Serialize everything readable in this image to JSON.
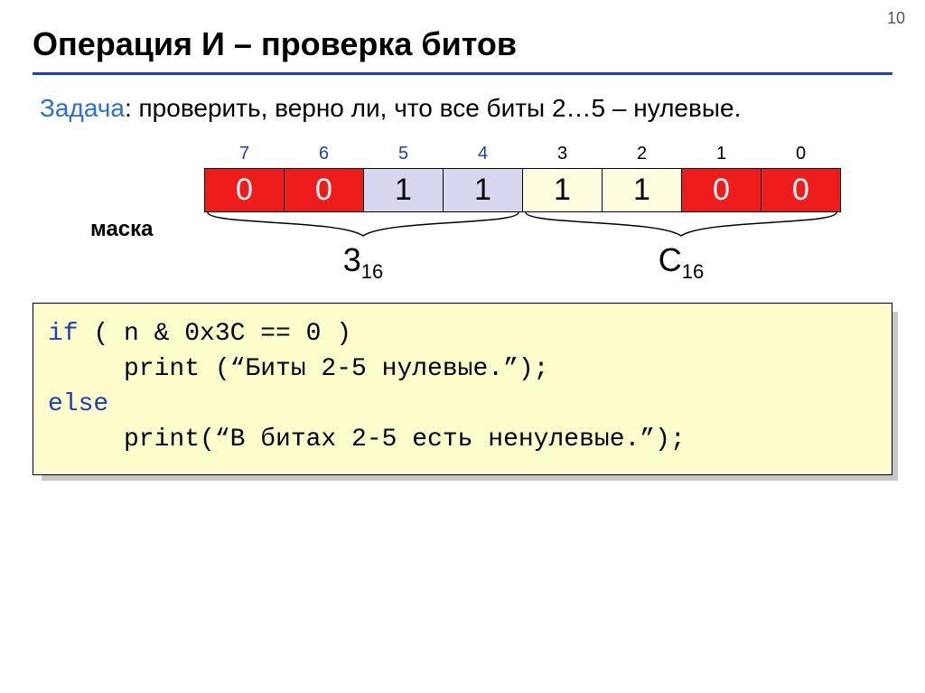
{
  "page_number": "10",
  "title": "Операция И – проверка битов",
  "task_label": "Задача",
  "task_text": ": проверить, верно ли, что все биты 2…5 – нулевые.",
  "mask_label": "маска",
  "bits": {
    "indices": [
      "7",
      "6",
      "5",
      "4",
      "3",
      "2",
      "1",
      "0"
    ],
    "blue_indices": {
      "7": true,
      "6": true,
      "5": true,
      "4": true
    },
    "values": [
      "0",
      "0",
      "1",
      "1",
      "1",
      "1",
      "0",
      "0"
    ],
    "colors": [
      "red",
      "red",
      "purple",
      "purple",
      "yellow",
      "yellow",
      "red",
      "red"
    ]
  },
  "hex_left_main": "3",
  "hex_left_sub": "16",
  "hex_right_main": "C",
  "hex_right_sub": "16",
  "code": {
    "l1a": "if",
    "l1b": " ( n & 0x3C == 0 )",
    "l2": "print (“Биты 2-5 нулевые.”);",
    "l3": "else",
    "l4": "print(“В битах 2-5 есть ненулевые.”);"
  }
}
